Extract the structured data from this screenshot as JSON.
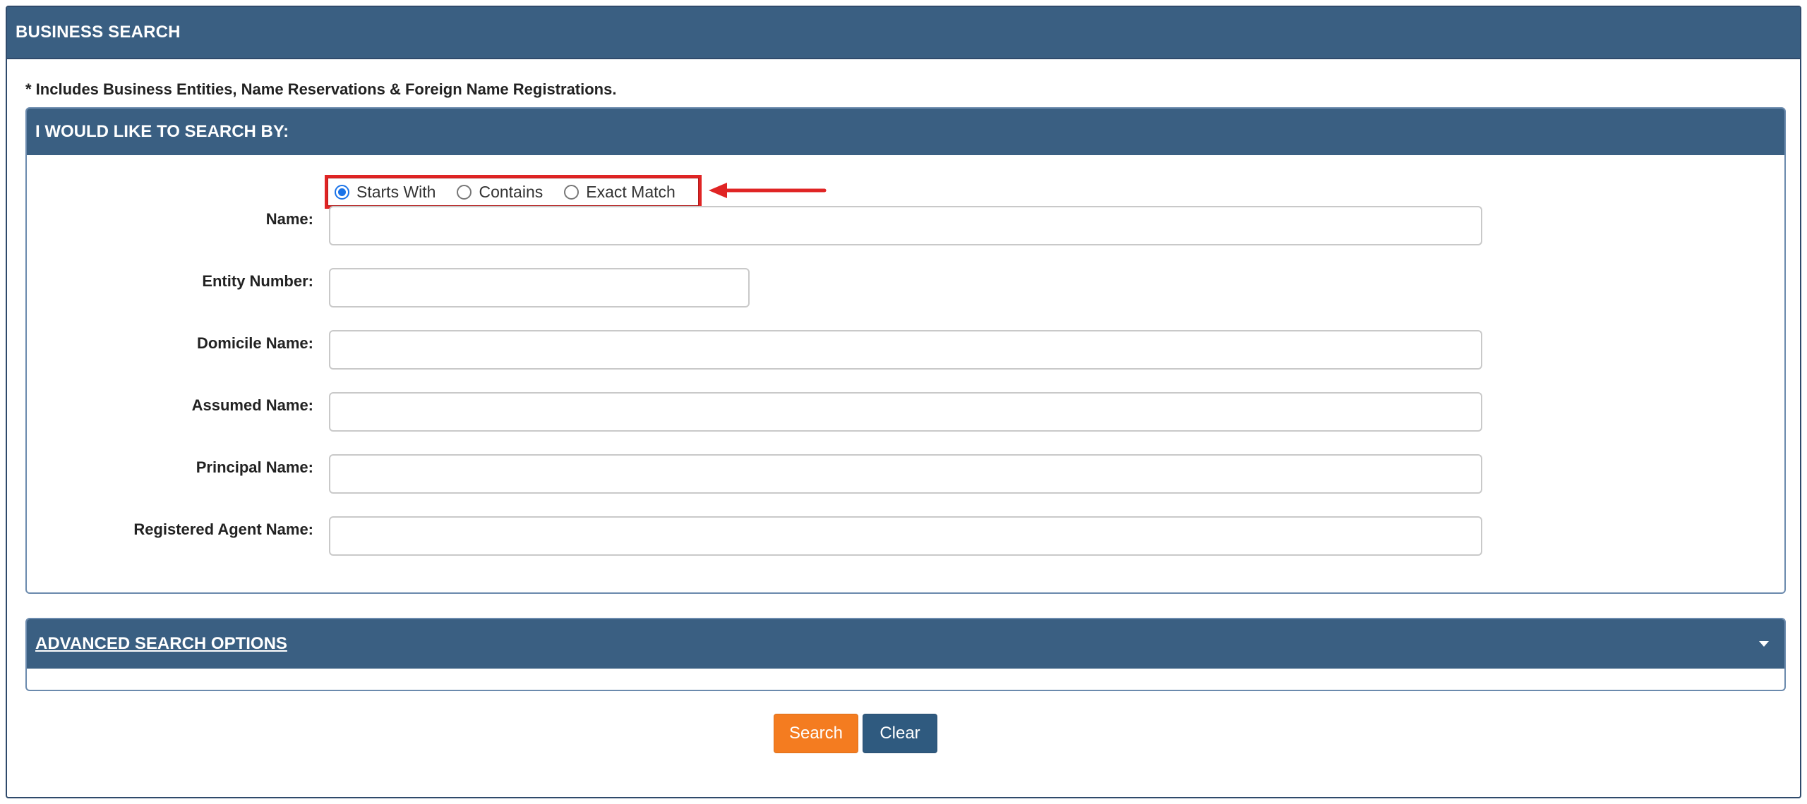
{
  "header": {
    "title": "BUSINESS SEARCH"
  },
  "note": "* Includes Business Entities, Name Reservations & Foreign Name Registrations.",
  "search_panel": {
    "title": "I WOULD LIKE TO SEARCH BY:",
    "match_options": [
      {
        "label": "Starts With",
        "selected": true
      },
      {
        "label": "Contains",
        "selected": false
      },
      {
        "label": "Exact Match",
        "selected": false
      }
    ],
    "fields": {
      "name": {
        "label": "Name:",
        "value": ""
      },
      "entity_number": {
        "label": "Entity Number:",
        "value": ""
      },
      "domicile_name": {
        "label": "Domicile Name:",
        "value": ""
      },
      "assumed_name": {
        "label": "Assumed Name:",
        "value": ""
      },
      "principal_name": {
        "label": "Principal Name:",
        "value": ""
      },
      "registered_agent_name": {
        "label": "Registered Agent Name:",
        "value": ""
      }
    }
  },
  "advanced": {
    "title": "ADVANCED SEARCH OPTIONS",
    "icon": "caret-down-icon"
  },
  "buttons": {
    "search": "Search",
    "clear": "Clear"
  },
  "colors": {
    "header_bg": "#3a5f82",
    "search_button": "#f47c20",
    "clear_button": "#2f5a7f",
    "annotation_red": "#e02424"
  }
}
